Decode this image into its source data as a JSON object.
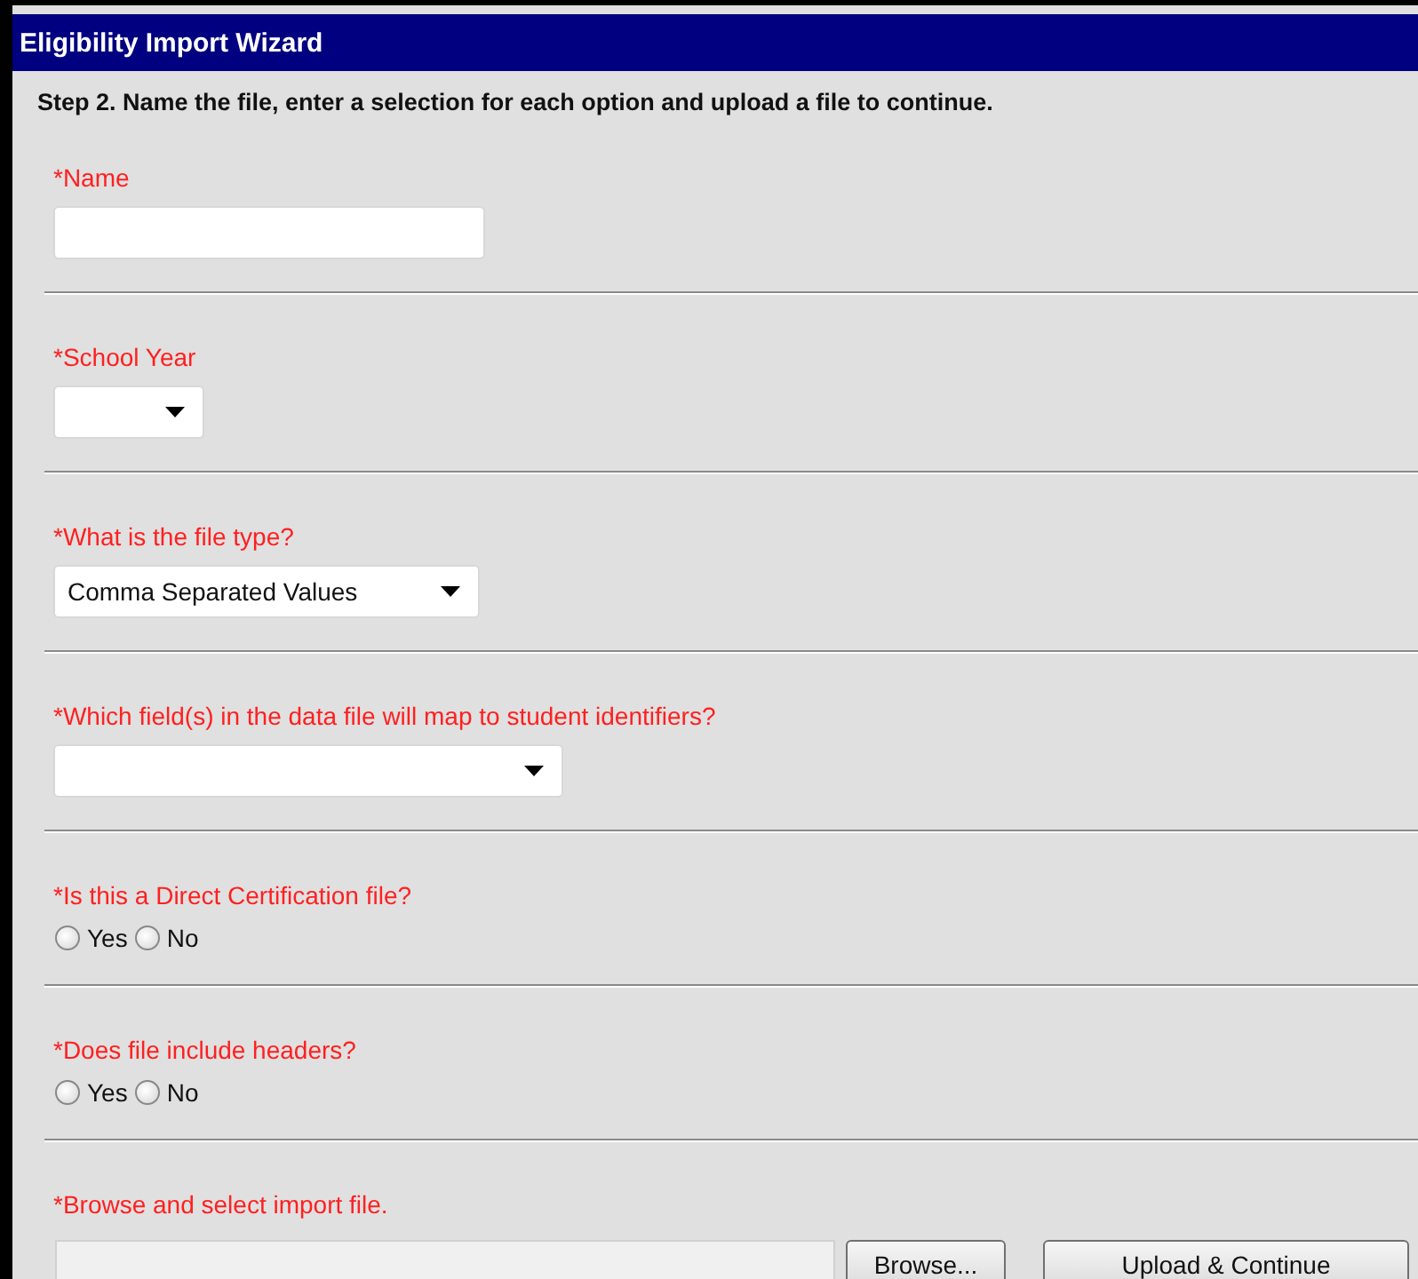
{
  "window": {
    "title": "Eligibility Import Wizard"
  },
  "instructions": "Step 2. Name the file, enter a selection for each option and upload a file to continue.",
  "sections": [
    {
      "kind": "text",
      "label": "*Name"
    },
    {
      "kind": "select",
      "label": "*School Year"
    },
    {
      "kind": "select",
      "label": "*What is the file type?",
      "value": "Comma Separated Values"
    },
    {
      "kind": "select",
      "label": "*Which field(s) in the data file will map to student identifiers?"
    },
    {
      "kind": "radio",
      "label": "*Is this a Direct Certification file?",
      "options": [
        {
          "label": "Yes",
          "selected": false
        },
        {
          "label": "No",
          "selected": false
        }
      ]
    },
    {
      "kind": "radio",
      "label": "*Does file include headers?",
      "options": [
        {
          "label": "Yes",
          "selected": false
        },
        {
          "label": "No",
          "selected": false
        }
      ]
    },
    {
      "kind": "file",
      "label": "*Browse and select import file.",
      "browse_button": "Browse...",
      "submit_button": "Upload & Continue"
    }
  ]
}
